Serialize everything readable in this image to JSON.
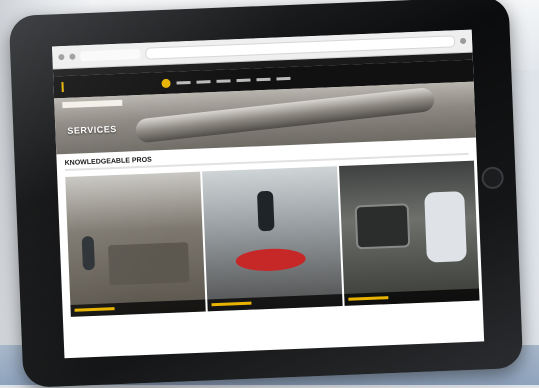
{
  "scene": {
    "device": "tablet",
    "colors": {
      "accent": "#e8b400",
      "bezel": "#0b0c0d"
    }
  },
  "website": {
    "hero_title": "SERVICES",
    "section_title": "KNOWLEDGEABLE PROS"
  }
}
